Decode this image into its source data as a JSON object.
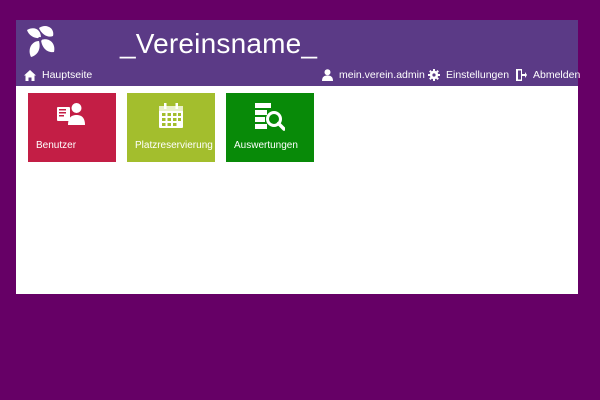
{
  "colors": {
    "page_background": "#660066",
    "header_background": "#5b3a86",
    "tile_benutzer": "#c31e45",
    "tile_platzreservierung": "#a3be2d",
    "tile_auswertungen": "#088a08"
  },
  "header": {
    "title": "_Vereinsname_",
    "home_label": "Hauptseite",
    "user_label": "mein.verein.admin",
    "settings_label": "Einstellungen",
    "logout_label": "Abmelden",
    "icons": [
      "logo-icon",
      "home-icon",
      "user-icon",
      "gear-icon",
      "logout-icon"
    ]
  },
  "tiles": [
    {
      "label": "Benutzer",
      "icon": "users-icon"
    },
    {
      "label": "Platzreservierung",
      "icon": "calendar-icon"
    },
    {
      "label": "Auswertungen",
      "icon": "report-search-icon"
    }
  ]
}
